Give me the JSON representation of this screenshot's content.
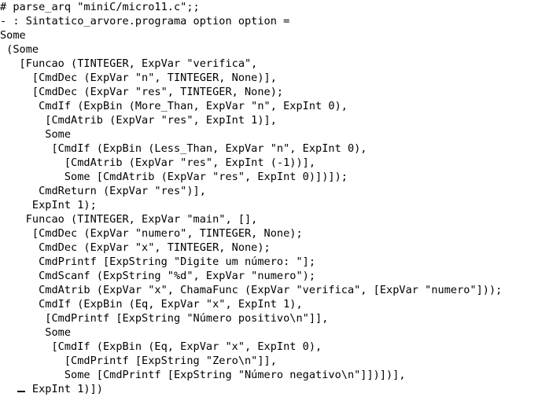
{
  "terminal": {
    "lines": [
      "# parse_arq \"miniC/micro11.c\";;",
      "- : Sintatico_arvore.programa option option =",
      "Some",
      " (Some",
      "   [Funcao (TINTEGER, ExpVar \"verifica\",",
      "     [CmdDec (ExpVar \"n\", TINTEGER, None)],",
      "     [CmdDec (ExpVar \"res\", TINTEGER, None);",
      "      CmdIf (ExpBin (More_Than, ExpVar \"n\", ExpInt 0),",
      "       [CmdAtrib (ExpVar \"res\", ExpInt 1)],",
      "       Some",
      "        [CmdIf (ExpBin (Less_Than, ExpVar \"n\", ExpInt 0),",
      "          [CmdAtrib (ExpVar \"res\", ExpInt (-1))],",
      "          Some [CmdAtrib (ExpVar \"res\", ExpInt 0)])]);",
      "      CmdReturn (ExpVar \"res\")],",
      "     ExpInt 1);",
      "    Funcao (TINTEGER, ExpVar \"main\", [],",
      "     [CmdDec (ExpVar \"numero\", TINTEGER, None);",
      "      CmdDec (ExpVar \"x\", TINTEGER, None);",
      "      CmdPrintf [ExpString \"Digite um número: \"];",
      "      CmdScanf (ExpString \"%d\", ExpVar \"numero\");",
      "      CmdAtrib (ExpVar \"x\", ChamaFunc (ExpVar \"verifica\", [ExpVar \"numero\"]));",
      "      CmdIf (ExpBin (Eq, ExpVar \"x\", ExpInt 1),",
      "       [CmdPrintf [ExpString \"Número positivo\\n\"]],",
      "       Some",
      "        [CmdIf (ExpBin (Eq, ExpVar \"x\", ExpInt 0),",
      "          [CmdPrintf [ExpString \"Zero\\n\"]],",
      "          Some [CmdPrintf [ExpString \"Número negativo\\n\"]])])],",
      "     ExpInt 1)])"
    ]
  }
}
